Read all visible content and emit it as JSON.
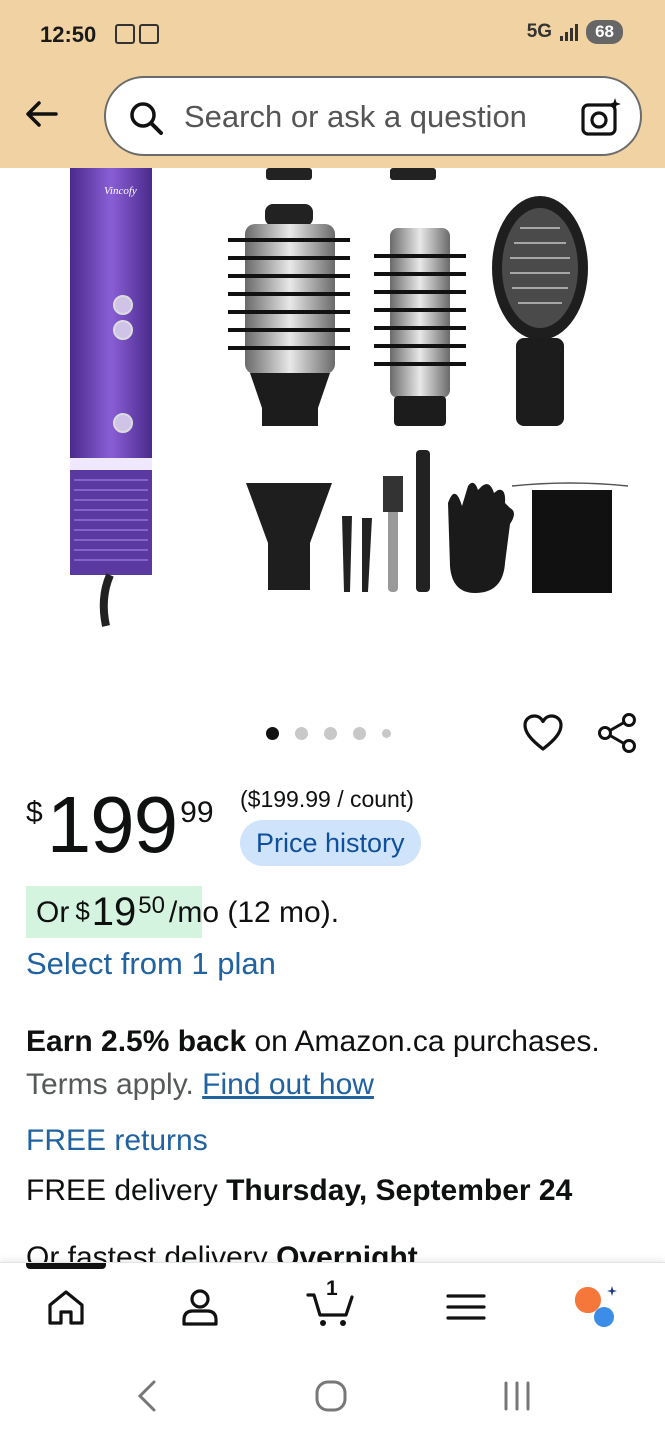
{
  "status_bar": {
    "time": "12:50",
    "network": "5G",
    "battery": "68"
  },
  "header": {
    "search_placeholder": "Search or ask a question"
  },
  "product": {
    "brand_on_image": "Vincofy",
    "carousel_total_dots": 5,
    "carousel_active_index": 0
  },
  "price": {
    "symbol": "$",
    "whole": "199",
    "fraction": "99",
    "unit_price": "($199.99 / count)",
    "price_history_label": "Price history"
  },
  "installment": {
    "prefix": "Or",
    "symbol": "$",
    "whole": "19",
    "fraction": "50",
    "suffix": "/mo (12 mo).",
    "select_plan": "Select from 1 plan"
  },
  "rewards": {
    "bold": "Earn 2.5% back",
    "text": " on Amazon.ca purchases.",
    "terms": " Terms apply. ",
    "link": "Find out how"
  },
  "delivery": {
    "free_returns": "FREE returns",
    "free_delivery_prefix": "FREE delivery ",
    "free_delivery_date": "Thursday, September 24",
    "fastest_prefix": "Or fastest delivery ",
    "fastest_value": "Overnight"
  },
  "bottom_nav": {
    "items": [
      "home-icon",
      "account-icon",
      "cart-icon",
      "menu-icon",
      "rufus-icon"
    ],
    "cart_count": "1"
  },
  "colors": {
    "header_bg": "#f1d3a3",
    "link": "#2162a1",
    "price_history_bg": "#cfe4fa",
    "installment_bg": "#d5f4e0",
    "product_purple": "#6b3fb8"
  }
}
